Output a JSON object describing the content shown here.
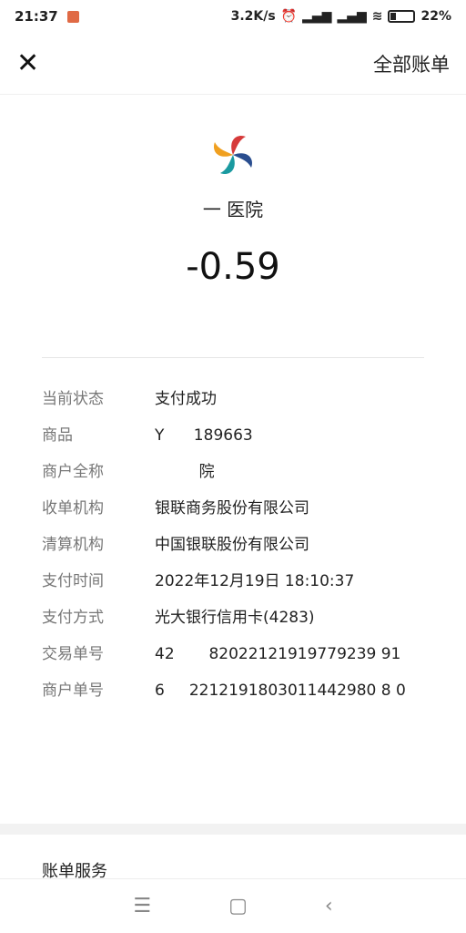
{
  "status_bar": {
    "time": "21:37",
    "speed": "3.2K/s",
    "battery": "22%"
  },
  "header": {
    "close_icon": "close-icon",
    "all_bills": "全部账单"
  },
  "merchant": {
    "name": "一 医院",
    "amount": "-0.59"
  },
  "details": [
    {
      "key": "当前状态",
      "value": "支付成功"
    },
    {
      "key": "商品",
      "value": "Y      189663"
    },
    {
      "key": "商户全称",
      "value": "         院"
    },
    {
      "key": "收单机构",
      "value": "银联商务股份有限公司"
    },
    {
      "key": "清算机构",
      "value": "中国银联股份有限公司"
    },
    {
      "key": "支付时间",
      "value": "2022年12月19日 18:10:37"
    },
    {
      "key": "支付方式",
      "value": "光大银行信用卡(4283)"
    },
    {
      "key": "交易单号",
      "value": "42       82022121919779239 91"
    },
    {
      "key": "商户单号",
      "value": "6     2212191803011442980 8 0"
    }
  ],
  "service": {
    "title": "账单服务"
  },
  "nav": {
    "menu": "☰",
    "home": "▢",
    "back": "‹"
  }
}
